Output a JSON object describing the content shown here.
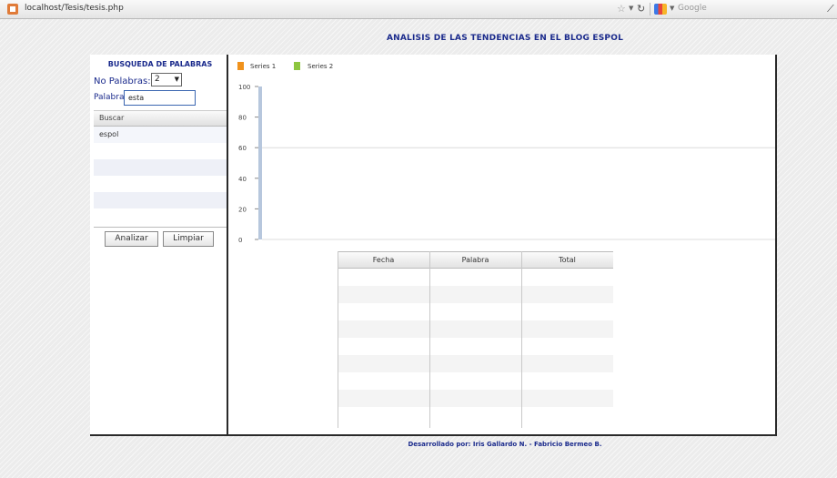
{
  "browser": {
    "url": "localhost/Tesis/tesis.php",
    "search_placeholder": "Google"
  },
  "page": {
    "title": "ANALISIS DE LAS TENDENCIAS EN EL BLOG ESPOL",
    "footer": "Desarrollado por: Iris Gallardo N. - Fabricio Bermeo B."
  },
  "sidebar": {
    "title": "BUSQUEDA DE PALABRAS",
    "nopalabras_label": "No Palabras:",
    "nopalabras_value": "2",
    "palabra_label": "Palabra:",
    "palabra_value": "esta",
    "list_header": "Buscar",
    "list_items": [
      "espol"
    ],
    "analizar_label": "Analizar",
    "limpiar_label": "Limpiar"
  },
  "chart_data": {
    "type": "bar",
    "series": [
      {
        "name": "Series 1",
        "color": "#f0921c",
        "values": []
      },
      {
        "name": "Series 2",
        "color": "#8dc63f",
        "values": []
      }
    ],
    "y_ticks": [
      "100",
      "80",
      "60",
      "40",
      "20",
      "0"
    ],
    "ylim": [
      0,
      100
    ],
    "legend_position": "top-left",
    "grid": true
  },
  "table": {
    "columns": [
      "Fecha",
      "Palabra",
      "Total"
    ],
    "rows": []
  },
  "colors": {
    "accent": "#1a2a8c",
    "frame_border": "#2a2a2a"
  }
}
